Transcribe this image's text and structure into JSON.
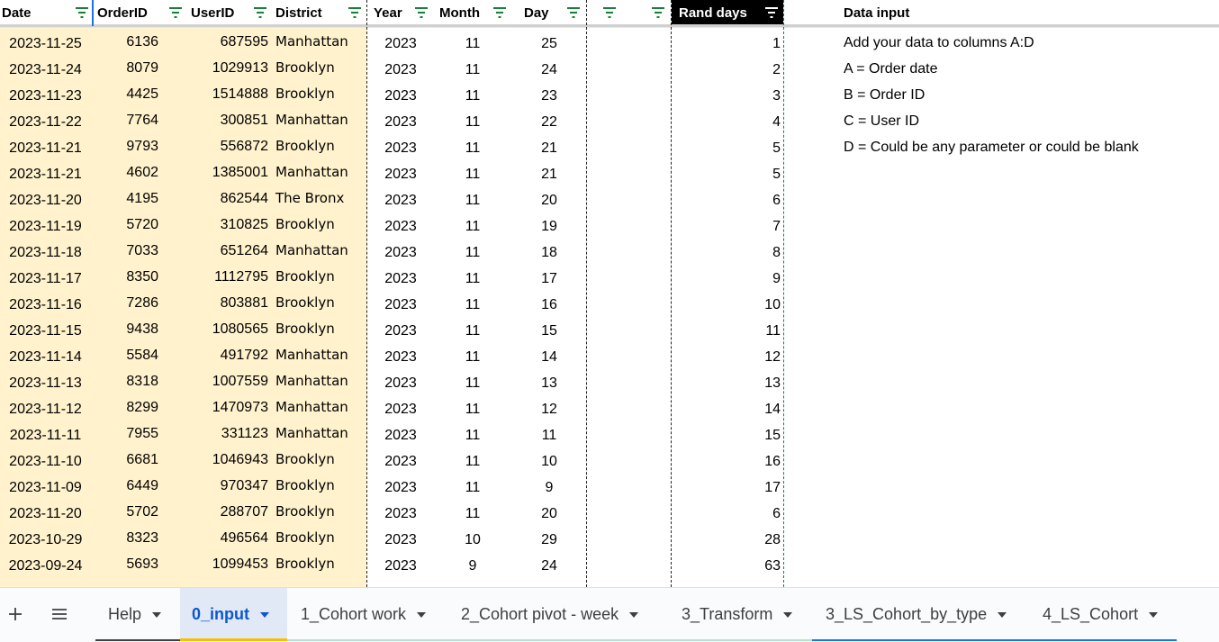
{
  "headers": {
    "date": "Date",
    "orderid": "OrderID",
    "userid": "UserID",
    "district": "District",
    "year": "Year",
    "month": "Month",
    "day": "Day",
    "rand": "Rand days",
    "data_input": "Data input"
  },
  "rows": [
    {
      "date": "2023-11-25",
      "orderid": "6136",
      "userid": "687595",
      "district": "Manhattan",
      "year": "2023",
      "month": "11",
      "day": "25",
      "rand": "1"
    },
    {
      "date": "2023-11-24",
      "orderid": "8079",
      "userid": "1029913",
      "district": "Brooklyn",
      "year": "2023",
      "month": "11",
      "day": "24",
      "rand": "2"
    },
    {
      "date": "2023-11-23",
      "orderid": "4425",
      "userid": "1514888",
      "district": "Brooklyn",
      "year": "2023",
      "month": "11",
      "day": "23",
      "rand": "3"
    },
    {
      "date": "2023-11-22",
      "orderid": "7764",
      "userid": "300851",
      "district": "Manhattan",
      "year": "2023",
      "month": "11",
      "day": "22",
      "rand": "4"
    },
    {
      "date": "2023-11-21",
      "orderid": "9793",
      "userid": "556872",
      "district": "Brooklyn",
      "year": "2023",
      "month": "11",
      "day": "21",
      "rand": "5"
    },
    {
      "date": "2023-11-21",
      "orderid": "4602",
      "userid": "1385001",
      "district": "Manhattan",
      "year": "2023",
      "month": "11",
      "day": "21",
      "rand": "5"
    },
    {
      "date": "2023-11-20",
      "orderid": "4195",
      "userid": "862544",
      "district": "The Bronx",
      "year": "2023",
      "month": "11",
      "day": "20",
      "rand": "6"
    },
    {
      "date": "2023-11-19",
      "orderid": "5720",
      "userid": "310825",
      "district": "Brooklyn",
      "year": "2023",
      "month": "11",
      "day": "19",
      "rand": "7"
    },
    {
      "date": "2023-11-18",
      "orderid": "7033",
      "userid": "651264",
      "district": "Manhattan",
      "year": "2023",
      "month": "11",
      "day": "18",
      "rand": "8"
    },
    {
      "date": "2023-11-17",
      "orderid": "8350",
      "userid": "1112795",
      "district": "Brooklyn",
      "year": "2023",
      "month": "11",
      "day": "17",
      "rand": "9"
    },
    {
      "date": "2023-11-16",
      "orderid": "7286",
      "userid": "803881",
      "district": "Brooklyn",
      "year": "2023",
      "month": "11",
      "day": "16",
      "rand": "10"
    },
    {
      "date": "2023-11-15",
      "orderid": "9438",
      "userid": "1080565",
      "district": "Brooklyn",
      "year": "2023",
      "month": "11",
      "day": "15",
      "rand": "11"
    },
    {
      "date": "2023-11-14",
      "orderid": "5584",
      "userid": "491792",
      "district": "Manhattan",
      "year": "2023",
      "month": "11",
      "day": "14",
      "rand": "12"
    },
    {
      "date": "2023-11-13",
      "orderid": "8318",
      "userid": "1007559",
      "district": "Manhattan",
      "year": "2023",
      "month": "11",
      "day": "13",
      "rand": "13"
    },
    {
      "date": "2023-11-12",
      "orderid": "8299",
      "userid": "1470973",
      "district": "Manhattan",
      "year": "2023",
      "month": "11",
      "day": "12",
      "rand": "14"
    },
    {
      "date": "2023-11-11",
      "orderid": "7955",
      "userid": "331123",
      "district": "Manhattan",
      "year": "2023",
      "month": "11",
      "day": "11",
      "rand": "15"
    },
    {
      "date": "2023-11-10",
      "orderid": "6681",
      "userid": "1046943",
      "district": "Brooklyn",
      "year": "2023",
      "month": "11",
      "day": "10",
      "rand": "16"
    },
    {
      "date": "2023-11-09",
      "orderid": "6449",
      "userid": "970347",
      "district": "Brooklyn",
      "year": "2023",
      "month": "11",
      "day": "9",
      "rand": "17"
    },
    {
      "date": "2023-11-20",
      "orderid": "5702",
      "userid": "288707",
      "district": "Brooklyn",
      "year": "2023",
      "month": "11",
      "day": "20",
      "rand": "6"
    },
    {
      "date": "2023-10-29",
      "orderid": "8323",
      "userid": "496564",
      "district": "Brooklyn",
      "year": "2023",
      "month": "10",
      "day": "29",
      "rand": "28"
    },
    {
      "date": "2023-09-24",
      "orderid": "5693",
      "userid": "1099453",
      "district": "Brooklyn",
      "year": "2023",
      "month": "9",
      "day": "24",
      "rand": "63"
    }
  ],
  "notes": [
    "Add your data to columns A:D",
    "A = Order date",
    "B = Order ID",
    "C = User ID",
    "D = Could be any parameter or could be blank"
  ],
  "tabs": [
    {
      "label": "Help",
      "active": false,
      "underline": "#3c4043"
    },
    {
      "label": "0_input",
      "active": true,
      "underline": "#fbbc04"
    },
    {
      "label": "1_Cohort work",
      "active": false,
      "underline": "#b7e1cd"
    },
    {
      "label": "2_Cohort pivot - week",
      "active": false,
      "underline": "#b7e1cd"
    },
    {
      "label": "3_Transform",
      "active": false,
      "underline": "#b7e1cd"
    },
    {
      "label": "3_LS_Cohort_by_type",
      "active": false,
      "underline": "#1a73e8"
    },
    {
      "label": "4_LS_Cohort",
      "active": false,
      "underline": "#1a73e8"
    }
  ],
  "toolbar": {
    "add_icon": "plus-icon",
    "menu_icon": "hamburger-menu-icon"
  },
  "colors": {
    "input_fill": "#fff2cc",
    "filter_icon": "#188038",
    "active_tab": "#0b57d0"
  }
}
